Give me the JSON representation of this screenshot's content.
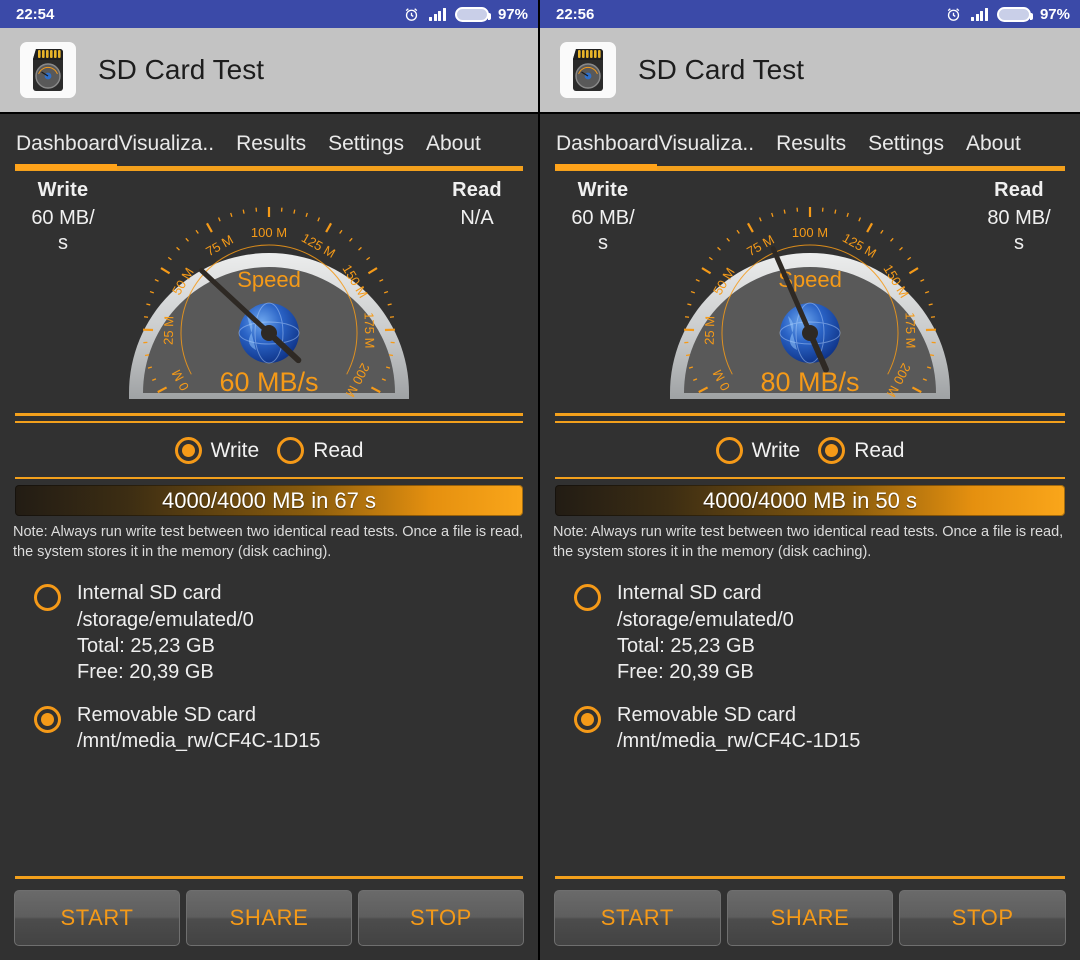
{
  "panels": [
    {
      "statusbar": {
        "time": "22:54",
        "battery": "97%",
        "alarm_icon": "alarm-icon",
        "signal_icon": "signal-icon",
        "battery_icon": "battery-icon"
      },
      "appbar": {
        "title": "SD Card Test",
        "icon": "sd-card-icon"
      },
      "tabs": [
        {
          "label": "Dashboard",
          "active": true
        },
        {
          "label": "Visualiza..",
          "active": false
        },
        {
          "label": "Results",
          "active": false
        },
        {
          "label": "Settings",
          "active": false
        },
        {
          "label": "About",
          "active": false
        }
      ],
      "write": {
        "caption": "Write",
        "value": "60 MB/",
        "value2": "s"
      },
      "read": {
        "caption": "Read",
        "value": "N/A",
        "value2": ""
      },
      "gauge": {
        "center_label": "Speed",
        "reading": "60 MB/s",
        "value": 60,
        "min": 0,
        "max": 200,
        "unit": "M",
        "ticks": [
          "0 M",
          "25 M",
          "50 M",
          "75 M",
          "100 M",
          "125 M",
          "150 M",
          "175 M",
          "200 M"
        ],
        "hub_icon": "globe-icon"
      },
      "mode": {
        "write_label": "Write",
        "read_label": "Read",
        "selected": "write"
      },
      "progress": {
        "text": "4000/4000 MB in 67 s",
        "percent": 100
      },
      "note": "Note: Always run write test between two identical read tests. Once a file is read, the system stores it in the memory (disk caching).",
      "storage": [
        {
          "name": "Internal SD card",
          "path": "/storage/emulated/0",
          "total": "Total: 25,23 GB",
          "free": "Free: 20,39 GB",
          "selected": false
        },
        {
          "name": "Removable SD card",
          "path": "/mnt/media_rw/CF4C-1D15",
          "total": "",
          "free": "",
          "selected": true
        }
      ],
      "buttons": [
        "START",
        "SHARE",
        "STOP"
      ]
    },
    {
      "statusbar": {
        "time": "22:56",
        "battery": "97%",
        "alarm_icon": "alarm-icon",
        "signal_icon": "signal-icon",
        "battery_icon": "battery-icon"
      },
      "appbar": {
        "title": "SD Card Test",
        "icon": "sd-card-icon"
      },
      "tabs": [
        {
          "label": "Dashboard",
          "active": true
        },
        {
          "label": "Visualiza..",
          "active": false
        },
        {
          "label": "Results",
          "active": false
        },
        {
          "label": "Settings",
          "active": false
        },
        {
          "label": "About",
          "active": false
        }
      ],
      "write": {
        "caption": "Write",
        "value": "60 MB/",
        "value2": "s"
      },
      "read": {
        "caption": "Read",
        "value": "80 MB/",
        "value2": "s"
      },
      "gauge": {
        "center_label": "Speed",
        "reading": "80 MB/s",
        "value": 80,
        "min": 0,
        "max": 200,
        "unit": "M",
        "ticks": [
          "0 M",
          "25 M",
          "50 M",
          "75 M",
          "100 M",
          "125 M",
          "150 M",
          "175 M",
          "200 M"
        ],
        "hub_icon": "globe-icon"
      },
      "mode": {
        "write_label": "Write",
        "read_label": "Read",
        "selected": "read"
      },
      "progress": {
        "text": "4000/4000 MB in 50 s",
        "percent": 100
      },
      "note": "Note: Always run write test between two identical read tests. Once a file is read, the system stores it in the memory (disk caching).",
      "storage": [
        {
          "name": "Internal SD card",
          "path": "/storage/emulated/0",
          "total": "Total: 25,23 GB",
          "free": "Free: 20,39 GB",
          "selected": false
        },
        {
          "name": "Removable SD card",
          "path": "/mnt/media_rw/CF4C-1D15",
          "total": "",
          "free": "",
          "selected": true
        }
      ],
      "buttons": [
        "START",
        "SHARE",
        "STOP"
      ]
    }
  ],
  "colors": {
    "accent": "#f59a18",
    "statusbar": "#3b4aa8",
    "appbar": "#c3c3c3",
    "content_bg": "#313131",
    "text": "#efefef"
  }
}
